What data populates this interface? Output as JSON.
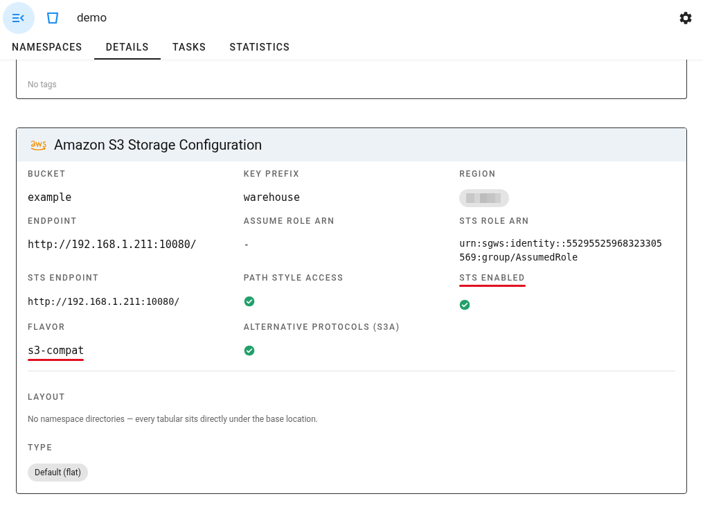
{
  "app_bar": {
    "title": "demo"
  },
  "tabs": [
    {
      "label": "NAMESPACES",
      "selected": false
    },
    {
      "label": "DETAILS",
      "selected": true
    },
    {
      "label": "TASKS",
      "selected": false
    },
    {
      "label": "STATISTICS",
      "selected": false
    }
  ],
  "tags_card": {
    "empty_text": "No tags"
  },
  "storage_card": {
    "title": "Amazon S3 Storage Configuration",
    "fields": [
      {
        "label": "BUCKET",
        "kind": "mono",
        "value": "example",
        "highlighted": false
      },
      {
        "label": "KEY PREFIX",
        "kind": "mono",
        "value": "warehouse",
        "highlighted": false
      },
      {
        "label": "REGION",
        "kind": "redacted",
        "highlighted": false
      },
      {
        "label": "ENDPOINT",
        "kind": "mono",
        "value": "http://192.168.1.211:10080/",
        "highlighted": false
      },
      {
        "label": "ASSUME ROLE ARN",
        "kind": "mono-small",
        "value": "-",
        "highlighted": false
      },
      {
        "label": "STS ROLE ARN",
        "kind": "mono-small",
        "value": "urn:sgws:identity::55295525968323305569:group/AssumedRole",
        "highlighted": false
      },
      {
        "label": "STS ENDPOINT",
        "kind": "mono-small",
        "value": "http://192.168.1.211:10080/",
        "highlighted": false
      },
      {
        "label": "PATH STYLE ACCESS",
        "kind": "check",
        "checked": true,
        "highlighted": false
      },
      {
        "label": "STS ENABLED",
        "kind": "check",
        "checked": true,
        "highlighted": true
      },
      {
        "label": "FLAVOR",
        "kind": "mono",
        "value": "s3-compat",
        "highlighted": true
      },
      {
        "label": "ALTERNATIVE PROTOCOLS (S3A)",
        "kind": "check",
        "checked": true,
        "highlighted": false
      }
    ],
    "layout": {
      "label": "LAYOUT",
      "description": "No namespace directories — every tabular sits directly under the base location.",
      "type_label": "TYPE",
      "type_value": "Default (flat)"
    }
  }
}
